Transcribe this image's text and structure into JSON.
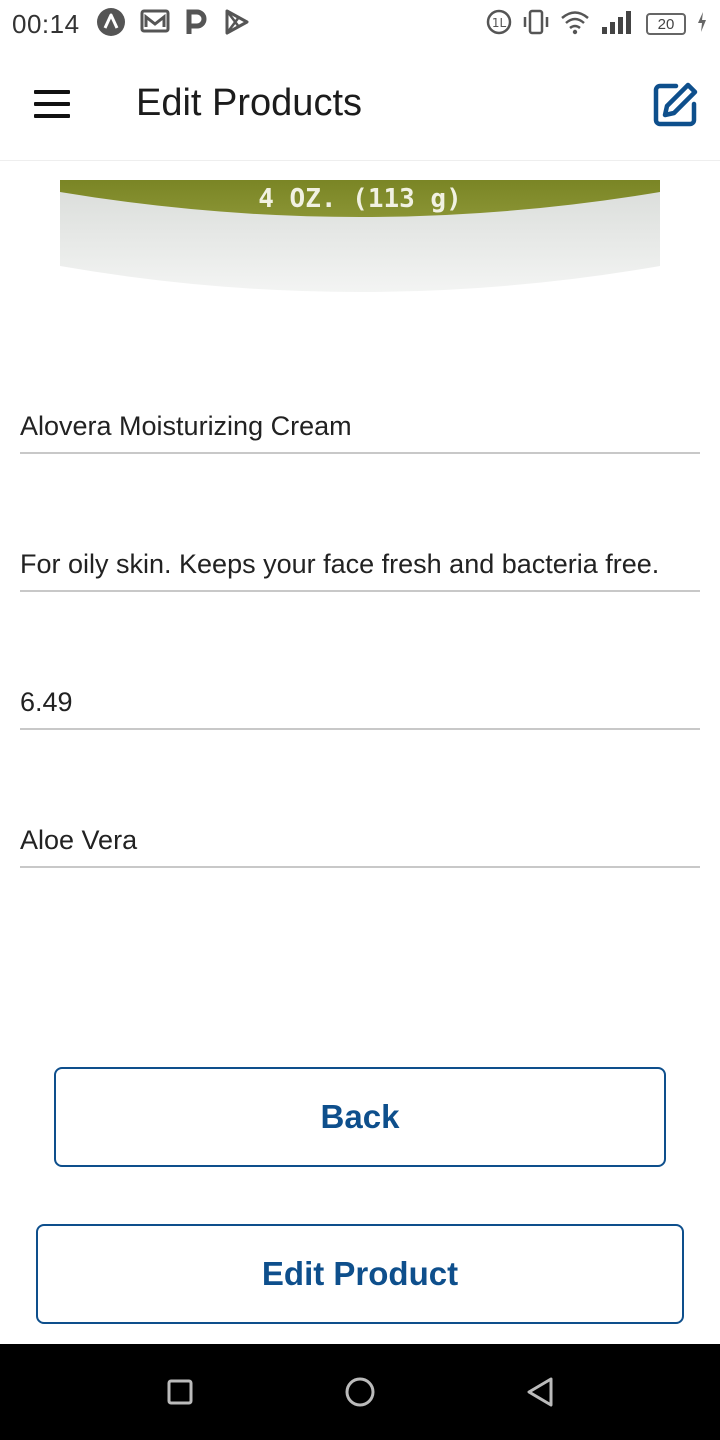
{
  "status_bar": {
    "time": "00:14",
    "battery_level": "20",
    "left_icons": [
      "app-a-icon",
      "mail-icon",
      "p-icon",
      "play-store-icon"
    ],
    "right_icons": [
      "data-saver-icon",
      "vibrate-icon",
      "wifi-icon",
      "signal-icon",
      "battery-icon",
      "charging-icon"
    ]
  },
  "app_bar": {
    "title": "Edit Products",
    "menu_icon": "hamburger-menu-icon",
    "action_icon": "edit-icon"
  },
  "product_image": {
    "label_text": "4 OZ. (113 g)"
  },
  "form": {
    "name": "Alovera Moisturizing Cream",
    "description": "For oily skin. Keeps your face fresh and bacteria free.",
    "price": "6.49",
    "category": "Aloe Vera"
  },
  "buttons": {
    "back_label": "Back",
    "edit_label": "Edit Product"
  },
  "nav_bar": {
    "items": [
      "recents-icon",
      "home-icon",
      "back-icon"
    ]
  },
  "colors": {
    "accent": "#0e4f8c",
    "underline": "#c8c8c8",
    "image_band": "#7f8a2c"
  }
}
